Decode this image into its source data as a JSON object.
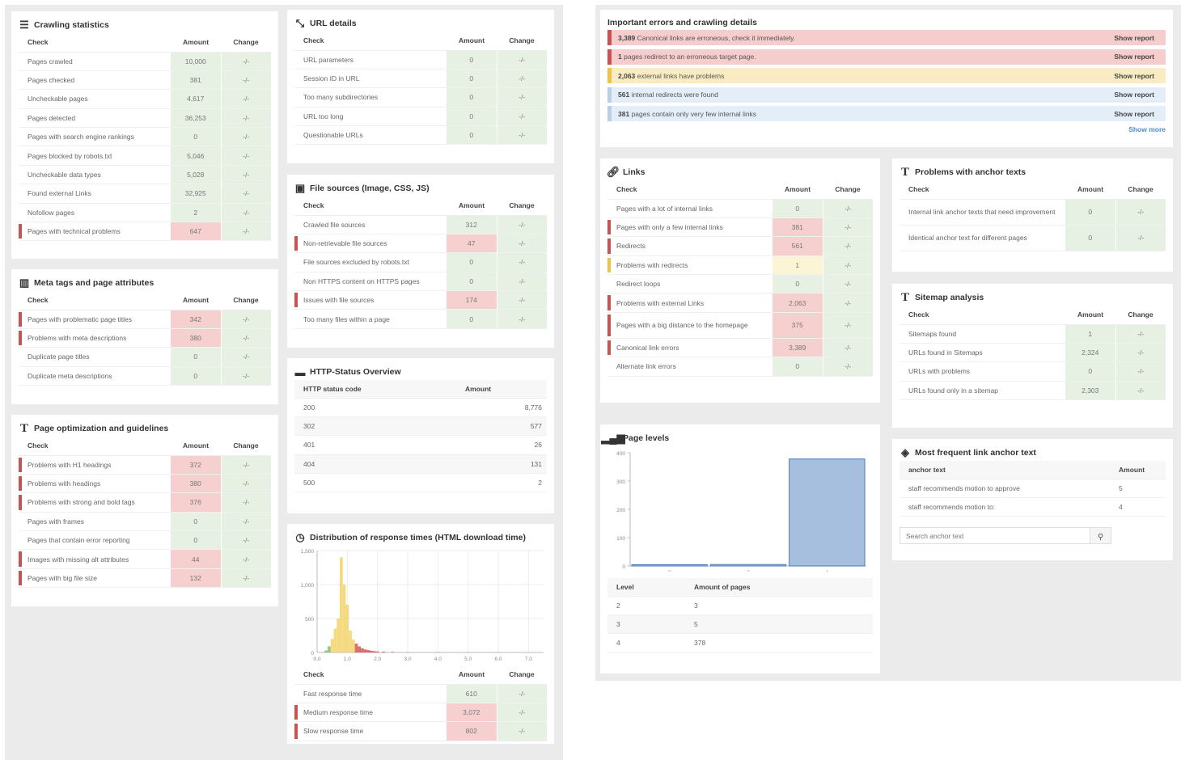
{
  "crawling": {
    "title": "Crawling statistics",
    "h_check": "Check",
    "h_amount": "Amount",
    "h_change": "Change",
    "rows": [
      {
        "label": "Pages crawled",
        "amount": "10,000",
        "change": "-/-",
        "status": "ok"
      },
      {
        "label": "Pages checked",
        "amount": "381",
        "change": "-/-",
        "status": "ok"
      },
      {
        "label": "Uncheckable pages",
        "amount": "4,617",
        "change": "-/-",
        "status": "ok"
      },
      {
        "label": "Pages detected",
        "amount": "36,253",
        "change": "-/-",
        "status": "ok"
      },
      {
        "label": "Pages with search engine rankings",
        "amount": "0",
        "change": "-/-",
        "status": "ok"
      },
      {
        "label": "Pages blocked by robots.txt",
        "amount": "5,046",
        "change": "-/-",
        "status": "ok"
      },
      {
        "label": "Uncheckable data types",
        "amount": "5,028",
        "change": "-/-",
        "status": "ok"
      },
      {
        "label": "Found external Links",
        "amount": "32,925",
        "change": "-/-",
        "status": "ok"
      },
      {
        "label": "Nofollow pages",
        "amount": "2",
        "change": "-/-",
        "status": "ok"
      },
      {
        "label": "Pages with technical problems",
        "amount": "647",
        "change": "-/-",
        "status": "red"
      }
    ]
  },
  "meta": {
    "title": "Meta tags and page attributes",
    "h_check": "Check",
    "h_amount": "Amount",
    "h_change": "Change",
    "rows": [
      {
        "label": "Pages with problematic page titles",
        "amount": "342",
        "change": "-/-",
        "status": "red"
      },
      {
        "label": "Problems with meta descriptions",
        "amount": "380",
        "change": "-/-",
        "status": "red"
      },
      {
        "label": "Duplicate page titles",
        "amount": "0",
        "change": "-/-",
        "status": "ok"
      },
      {
        "label": "Duplicate meta descriptions",
        "amount": "0",
        "change": "-/-",
        "status": "ok"
      }
    ]
  },
  "pageopt": {
    "title": "Page optimization and guidelines",
    "h_check": "Check",
    "h_amount": "Amount",
    "h_change": "Change",
    "rows": [
      {
        "label": "Problems with H1 headings",
        "amount": "372",
        "change": "-/-",
        "status": "red"
      },
      {
        "label": "Problems with headings",
        "amount": "380",
        "change": "-/-",
        "status": "red"
      },
      {
        "label": "Problems with strong and bold tags",
        "amount": "376",
        "change": "-/-",
        "status": "red"
      },
      {
        "label": "Pages with frames",
        "amount": "0",
        "change": "-/-",
        "status": "ok"
      },
      {
        "label": "Pages that contain error reporting",
        "amount": "0",
        "change": "-/-",
        "status": "ok"
      },
      {
        "label": "Images with missing alt attributes",
        "amount": "44",
        "change": "-/-",
        "status": "red"
      },
      {
        "label": "Pages with big file size",
        "amount": "132",
        "change": "-/-",
        "status": "red"
      }
    ]
  },
  "url": {
    "title": "URL details",
    "h_check": "Check",
    "h_amount": "Amount",
    "h_change": "Change",
    "rows": [
      {
        "label": "URL parameters",
        "amount": "0",
        "change": "-/-",
        "status": "ok"
      },
      {
        "label": "Session ID in URL",
        "amount": "0",
        "change": "-/-",
        "status": "ok"
      },
      {
        "label": "Too many subdirectories",
        "amount": "0",
        "change": "-/-",
        "status": "ok"
      },
      {
        "label": "URL too long",
        "amount": "0",
        "change": "-/-",
        "status": "ok"
      },
      {
        "label": "Questionable URLs",
        "amount": "0",
        "change": "-/-",
        "status": "ok"
      }
    ]
  },
  "files": {
    "title": "File sources (Image, CSS, JS)",
    "h_check": "Check",
    "h_amount": "Amount",
    "h_change": "Change",
    "rows": [
      {
        "label": "Crawled file sources",
        "amount": "312",
        "change": "-/-",
        "status": "ok"
      },
      {
        "label": "Non-retrievable file sources",
        "amount": "47",
        "change": "-/-",
        "status": "red"
      },
      {
        "label": "File sources excluded by robots.txt",
        "amount": "0",
        "change": "-/-",
        "status": "ok"
      },
      {
        "label": "Non HTTPS content on HTTPS pages",
        "amount": "0",
        "change": "-/-",
        "status": "ok"
      },
      {
        "label": "Issues with file sources",
        "amount": "174",
        "change": "-/-",
        "status": "red"
      },
      {
        "label": "Too many files within a page",
        "amount": "0",
        "change": "-/-",
        "status": "ok"
      }
    ]
  },
  "http": {
    "title": "HTTP-Status Overview",
    "h_code": "HTTP status code",
    "h_amount": "Amount",
    "rows": [
      {
        "code": "200",
        "amount": "8,776"
      },
      {
        "code": "302",
        "amount": "577"
      },
      {
        "code": "401",
        "amount": "26"
      },
      {
        "code": "404",
        "amount": "131"
      },
      {
        "code": "500",
        "amount": "2"
      }
    ]
  },
  "resp": {
    "title": "Distribution of response times (HTML download time)",
    "yticks": [
      "1,500",
      "1,000",
      "500",
      "0"
    ],
    "xticks": [
      "0.0",
      "1.0",
      "2.0",
      "3.0",
      "4.0",
      "5.0",
      "6.0",
      "7.0"
    ],
    "h_check": "Check",
    "h_amount": "Amount",
    "h_change": "Change",
    "rows": [
      {
        "label": "Fast response time",
        "amount": "610",
        "change": "-/-",
        "status": "ok"
      },
      {
        "label": "Medium response time",
        "amount": "3,072",
        "change": "-/-",
        "status": "red"
      },
      {
        "label": "Slow response time",
        "amount": "802",
        "change": "-/-",
        "status": "red"
      }
    ]
  },
  "important": {
    "title": "Important errors and crawling details",
    "show_more": "Show more",
    "rows": [
      {
        "num": "3,389",
        "text": "Canonical links are erroneous, check it immediately.",
        "link": "Show report",
        "color": "red"
      },
      {
        "num": "1",
        "text": "pages redirect to an erroneous target page.",
        "link": "Show report",
        "color": "red"
      },
      {
        "num": "2,063",
        "text": "external links have problems",
        "link": "Show report",
        "color": "yel"
      },
      {
        "num": "561",
        "text": "internal redirects were found",
        "link": "Show report",
        "color": "blu"
      },
      {
        "num": "381",
        "text": "pages contain only very few internal links",
        "link": "Show report",
        "color": "blu"
      }
    ]
  },
  "links": {
    "title": "Links",
    "h_check": "Check",
    "h_amount": "Amount",
    "h_change": "Change",
    "rows": [
      {
        "label": "Pages with a lot of internal links",
        "amount": "0",
        "change": "-/-",
        "status": "ok"
      },
      {
        "label": "Pages with only a few internal links",
        "amount": "381",
        "change": "-/-",
        "status": "red"
      },
      {
        "label": "Redirects",
        "amount": "561",
        "change": "-/-",
        "status": "red"
      },
      {
        "label": "Problems with redirects",
        "amount": "1",
        "change": "-/-",
        "status": "yel"
      },
      {
        "label": "Redirect loops",
        "amount": "0",
        "change": "-/-",
        "status": "ok"
      },
      {
        "label": "Problems with external Links",
        "amount": "2,063",
        "change": "-/-",
        "status": "red"
      },
      {
        "label": "Pages with a big distance to the homepage",
        "amount": "375",
        "change": "-/-",
        "status": "red"
      },
      {
        "label": "Canonical link errors",
        "amount": "3,389",
        "change": "-/-",
        "status": "red"
      },
      {
        "label": "Alternate link errors",
        "amount": "0",
        "change": "-/-",
        "status": "ok"
      }
    ]
  },
  "anchor": {
    "title": "Problems with anchor texts",
    "h_check": "Check",
    "h_amount": "Amount",
    "h_change": "Change",
    "rows": [
      {
        "label": "Internal link anchor texts that need improvement",
        "amount": "0",
        "change": "-/-",
        "status": "ok"
      },
      {
        "label": "Identical anchor text for different pages",
        "amount": "0",
        "change": "-/-",
        "status": "ok"
      }
    ]
  },
  "sitemap": {
    "title": "Sitemap analysis",
    "h_check": "Check",
    "h_amount": "Amount",
    "h_change": "Change",
    "rows": [
      {
        "label": "Sitemaps found",
        "amount": "1",
        "change": "-/-",
        "status": "ok"
      },
      {
        "label": "URLs found in Sitemaps",
        "amount": "2,324",
        "change": "-/-",
        "status": "ok"
      },
      {
        "label": "URLs with problems",
        "amount": "0",
        "change": "-/-",
        "status": "ok"
      },
      {
        "label": "URLs found only in a sitemap",
        "amount": "2,303",
        "change": "-/-",
        "status": "ok"
      }
    ]
  },
  "levels": {
    "title": "Page levels",
    "h_level": "Level",
    "h_amount": "Amount of pages",
    "rows": [
      {
        "level": "2",
        "amount": "3"
      },
      {
        "level": "3",
        "amount": "5"
      },
      {
        "level": "4",
        "amount": "378"
      }
    ]
  },
  "frequent": {
    "title": "Most frequent link anchor text",
    "h_anchor": "anchor text",
    "h_amount": "Amount",
    "rows": [
      {
        "text": "staff recommends motion to approve",
        "amount": "5"
      },
      {
        "text": "staff recommends motion to:",
        "amount": "4"
      }
    ],
    "search_placeholder": "Search anchor text"
  },
  "chart_data": [
    {
      "type": "bar",
      "title": "Page levels",
      "categories": [
        "2",
        "3",
        "4"
      ],
      "values": [
        3,
        5,
        378
      ],
      "ylim": [
        0,
        400
      ],
      "yticks": [
        "0",
        "100",
        "200",
        "300",
        "400"
      ]
    },
    {
      "type": "bar",
      "title": "Distribution of response times (HTML download time)",
      "xlim": [
        0,
        7.5
      ],
      "ylim": [
        0,
        1500
      ],
      "x": [
        0.2,
        0.3,
        0.4,
        0.5,
        0.6,
        0.7,
        0.8,
        0.9,
        1.0,
        1.1,
        1.2,
        1.3,
        1.4,
        1.5,
        1.6,
        1.7,
        1.8,
        1.9,
        2.0,
        2.2,
        2.5,
        3.0,
        4.0,
        5.0,
        6.0,
        7.0
      ],
      "values": [
        5,
        30,
        90,
        200,
        350,
        500,
        1400,
        1000,
        700,
        320,
        190,
        130,
        90,
        60,
        45,
        35,
        25,
        20,
        15,
        12,
        8,
        5,
        4,
        3,
        2,
        1
      ]
    }
  ]
}
